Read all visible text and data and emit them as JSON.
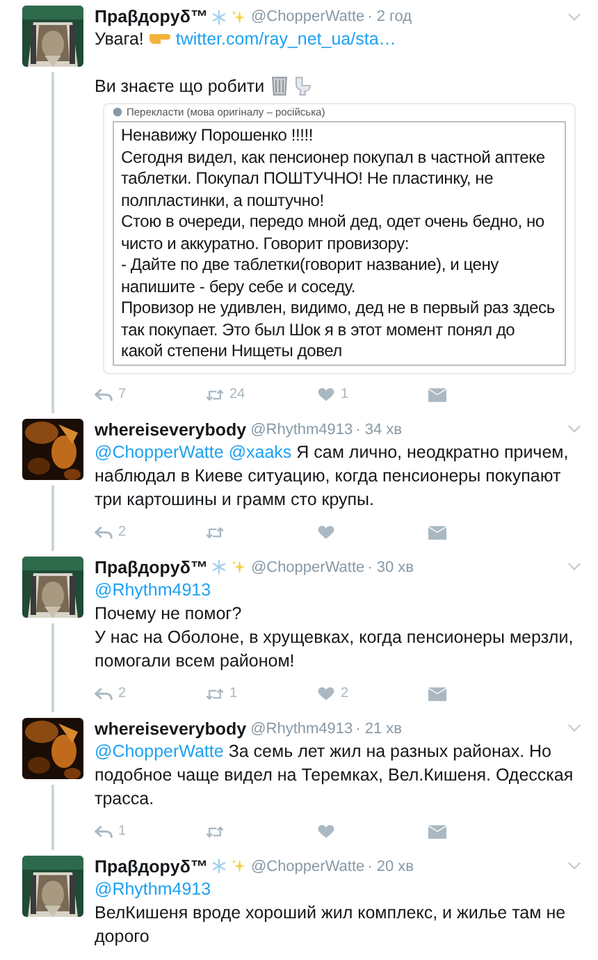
{
  "tweets": [
    {
      "name": "Праβдорyδ™",
      "badges": true,
      "handle": "@ChopperWatte",
      "time": "· 2 год",
      "paragraphs": [
        [
          {
            "kind": "text",
            "text": "Увага!"
          },
          {
            "kind": "hand"
          },
          {
            "kind": "link",
            "text": "twitter.com/ray_net_ua/sta…"
          }
        ],
        [
          {
            "kind": "text",
            "text": "Ви знаєте що робити"
          },
          {
            "kind": "bin"
          },
          {
            "kind": "toilet"
          }
        ]
      ],
      "quote": {
        "caption": "Перекласти (мова оригіналу – російська)",
        "paragraphs": [
          "Ненавижу Порошенко !!!!!",
          "Сегодня видел, как пенсионер покупал в частной аптеке таблетки. Покупал ПОШТУЧНО! Не пластинку, не полпластинки, а поштучно!",
          "Стою в очереди, передо мной дед, одет очень бедно, но чисто и аккуратно. Говорит провизору:",
          "- Дайте по две таблетки(говорит название), и цену напишите - беру себе и соседу.",
          "Провизор не удивлен, видимо, дед не в первый раз здесь так покупает. Это был Шок я в этот момент понял до какой степени Нищеты довел"
        ]
      },
      "actions": [
        {
          "kind": "reply",
          "count": "7"
        },
        {
          "kind": "retweet",
          "count": "24"
        },
        {
          "kind": "like",
          "count": "1"
        },
        {
          "kind": "message"
        }
      ]
    },
    {
      "name": "whereiseverybody",
      "badges": false,
      "handle": "@Rhythm4913",
      "time": "· 34 хв",
      "paragraphs": [
        [
          {
            "kind": "mention",
            "text": "@ChopperWatte"
          },
          {
            "kind": "mention",
            "text": "@xaaks"
          },
          {
            "kind": "text",
            "text": "Я сам лично, неодкратно причем, наблюдал в Киеве ситуацию, когда пенсионеры покупают три картошины и грамм сто крупы."
          }
        ]
      ],
      "actions": [
        {
          "kind": "reply",
          "count": "2"
        },
        {
          "kind": "retweet"
        },
        {
          "kind": "like"
        },
        {
          "kind": "message"
        }
      ]
    },
    {
      "name": "Праβдорyδ™",
      "badges": true,
      "handle": "@ChopperWatte",
      "time": "· 30 хв",
      "paragraphs": [
        [
          {
            "kind": "mention",
            "text": "@Rhythm4913"
          }
        ],
        [
          {
            "kind": "text",
            "text": "Почему не помог?"
          }
        ],
        [
          {
            "kind": "text",
            "text": "У нас на Оболоне, в хрущевках, когда пенсионеры мерзли, помогали всем районом!"
          }
        ]
      ],
      "actions": [
        {
          "kind": "reply",
          "count": "2"
        },
        {
          "kind": "retweet",
          "count": "1"
        },
        {
          "kind": "like",
          "count": "2"
        },
        {
          "kind": "message"
        }
      ]
    },
    {
      "name": "whereiseverybody",
      "badges": false,
      "handle": "@Rhythm4913",
      "time": "· 21 хв",
      "paragraphs": [
        [
          {
            "kind": "mention",
            "text": "@ChopperWatte"
          },
          {
            "kind": "text",
            "text": "За семь лет жил на разных районах. Но подобное чаще видел на Теремках, Вел.Кишеня. Одесская трасса."
          }
        ]
      ],
      "actions": [
        {
          "kind": "reply",
          "count": "1"
        },
        {
          "kind": "retweet"
        },
        {
          "kind": "like"
        },
        {
          "kind": "message"
        }
      ]
    },
    {
      "name": "Праβдорyδ™",
      "badges": true,
      "handle": "@ChopperWatte",
      "time": "· 20 хв",
      "paragraphs": [
        [
          {
            "kind": "mention",
            "text": "@Rhythm4913"
          }
        ],
        [
          {
            "kind": "text",
            "text": "ВелКишеня вроде хороший жил комплекс, и жилье там не дорого"
          }
        ]
      ]
    }
  ]
}
